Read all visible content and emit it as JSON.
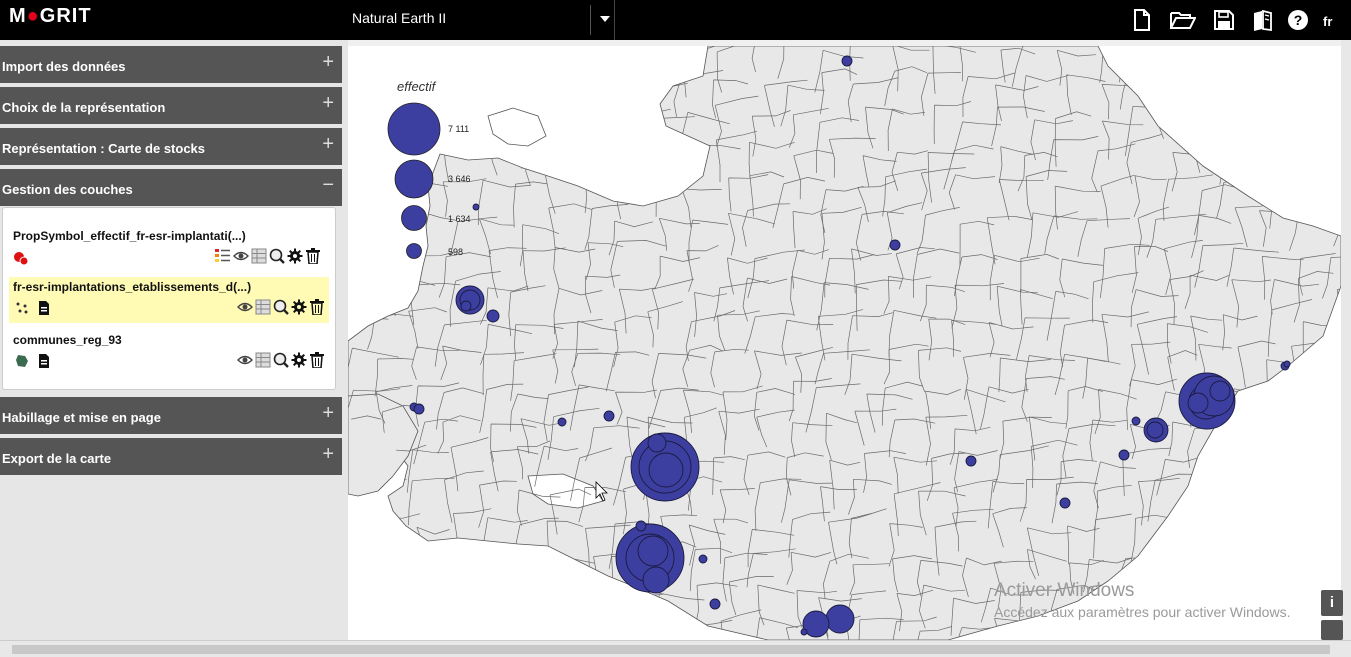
{
  "header": {
    "logo": "MAGRIT",
    "basemap": "Natural Earth II",
    "icons": [
      "new-file-icon",
      "open-folder-icon",
      "save-icon",
      "book-icon",
      "help-icon"
    ],
    "lang": "fr"
  },
  "sections": {
    "import": "Import des données",
    "choice": "Choix de la représentation",
    "representation": "Représentation : Carte de stocks",
    "layers": "Gestion des couches",
    "layout": "Habillage et mise en page",
    "export": "Export de la carte"
  },
  "layers": [
    {
      "name": "PropSymbol_effectif_fr-esr-implantati(...)"
    },
    {
      "name": "fr-esr-implantations_etablissements_d(...)"
    },
    {
      "name": "communes_reg_93"
    }
  ],
  "map": {
    "legend": {
      "title": "effectif",
      "values": [
        "7 111",
        "3 646",
        "1 634",
        "598"
      ]
    },
    "symbol_color": "#3d3fa0",
    "area_color": "#e8e8e8"
  },
  "watermark": {
    "line1": "Activer Windows",
    "line2": "Accédez aux paramètres pour activer Windows."
  },
  "info_label": "i"
}
